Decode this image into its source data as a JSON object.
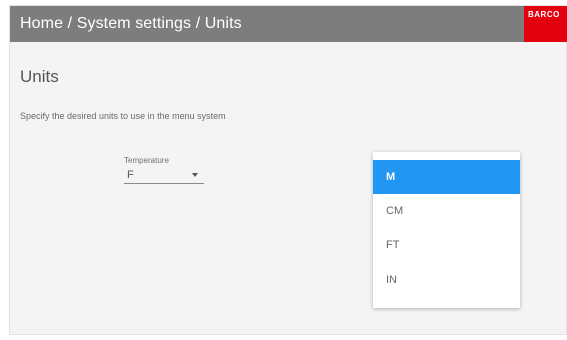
{
  "header": {
    "breadcrumb": "Home / System settings / Units",
    "logo_text": "BARCO",
    "background": "#7d7d7d",
    "logo_color": "#e3000f"
  },
  "page": {
    "title": "Units",
    "description": "Specify the desired units to use in the menu system"
  },
  "temperature": {
    "label": "Temperature",
    "value": "F"
  },
  "dropdown": {
    "options": [
      {
        "label": "M",
        "selected": true
      },
      {
        "label": "CM",
        "selected": false
      },
      {
        "label": "FT",
        "selected": false
      },
      {
        "label": "IN",
        "selected": false
      }
    ],
    "selected_color": "#2196f3"
  }
}
